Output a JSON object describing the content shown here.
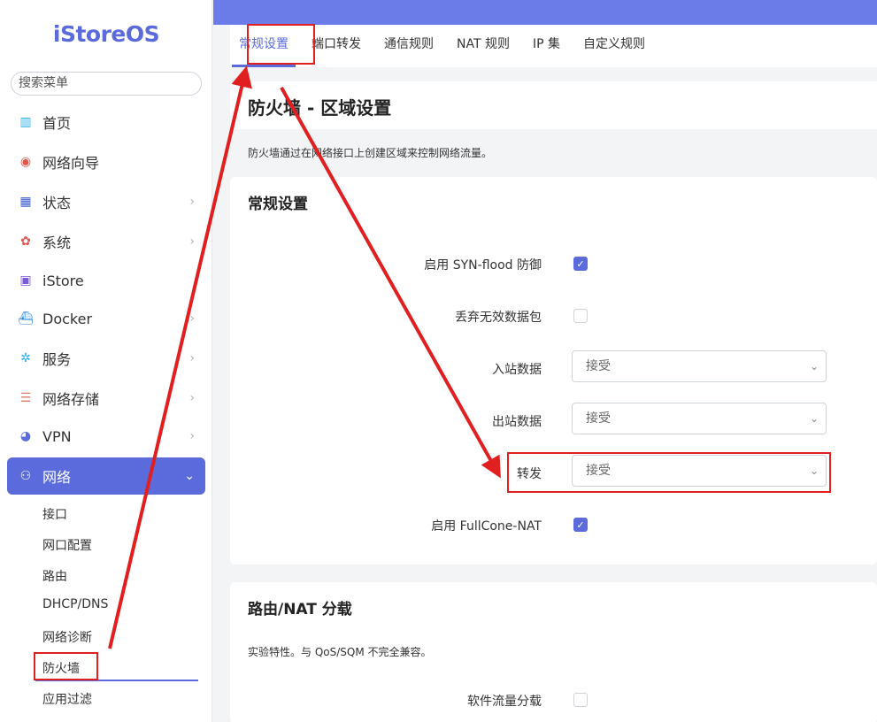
{
  "sidebar": {
    "logo": "iStoreOS",
    "search_placeholder": "搜索菜单",
    "items": [
      {
        "label": "首页"
      },
      {
        "label": "网络向导"
      },
      {
        "label": "状态"
      },
      {
        "label": "系统"
      },
      {
        "label": "iStore"
      },
      {
        "label": "Docker"
      },
      {
        "label": "服务"
      },
      {
        "label": "网络存储"
      },
      {
        "label": "VPN"
      },
      {
        "label": "网络"
      }
    ],
    "subitems": [
      "接口",
      "网口配置",
      "路由",
      "DHCP/DNS",
      "网络诊断",
      "防火墙",
      "应用过滤"
    ]
  },
  "tabs": [
    "常规设置",
    "端口转发",
    "通信规则",
    "NAT 规则",
    "IP 集",
    "自定义规则"
  ],
  "page": {
    "title": "防火墙 - 区域设置",
    "description": "防火墙通过在网络接口上创建区域来控制网络流量。"
  },
  "general": {
    "title": "常规设置",
    "syn_flood_label": "启用 SYN-flood 防御",
    "drop_invalid_label": "丢弃无效数据包",
    "input_label": "入站数据",
    "input_value": "接受",
    "output_label": "出站数据",
    "output_value": "接受",
    "forward_label": "转发",
    "forward_value": "接受",
    "fullcone_label": "启用 FullCone-NAT"
  },
  "offload": {
    "title": "路由/NAT 分载",
    "description": "实验特性。与 QoS/SQM 不完全兼容。",
    "software_label": "软件流量分载"
  },
  "colors": {
    "accent": "#5b6bdc",
    "annotation": "#e02020"
  }
}
